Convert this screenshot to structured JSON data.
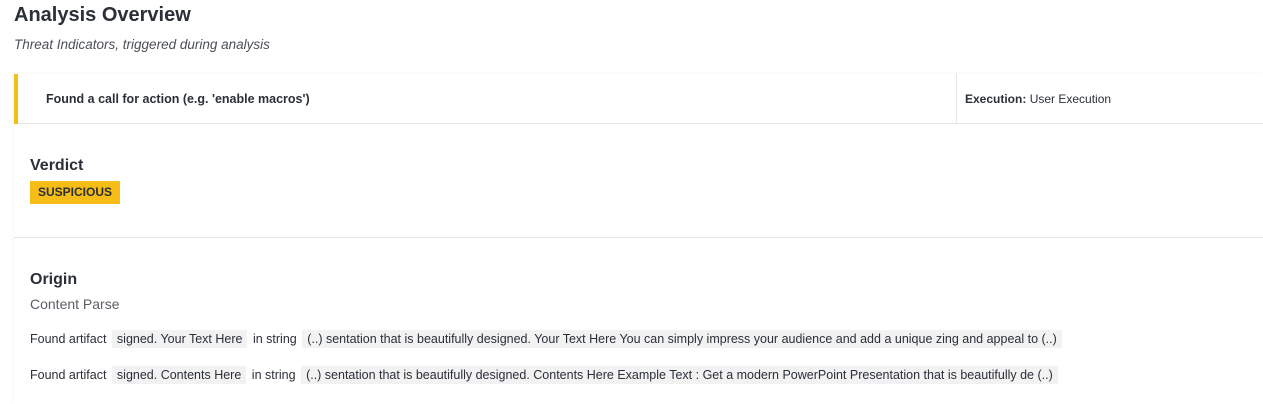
{
  "header": {
    "title": "Analysis Overview",
    "subtitle": "Threat Indicators, triggered during analysis"
  },
  "indicator": {
    "description": "Found a call for action (e.g. 'enable macros')",
    "category_label": "Execution:",
    "category_value": "User Execution",
    "accent_color": "#f6bd17"
  },
  "verdict": {
    "heading": "Verdict",
    "badge": "SUSPICIOUS",
    "badge_color": "#f6bd17"
  },
  "origin": {
    "heading": "Origin",
    "source": "Content Parse",
    "artifacts": [
      {
        "prefix": "Found artifact",
        "artifact": "signed. Your Text Here",
        "middle": "in string",
        "string": "(..) sentation that is beautifully designed. Your Text Here You can simply impress your audience and add a unique zing and appeal to  (..)"
      },
      {
        "prefix": "Found artifact",
        "artifact": "signed. Contents Here",
        "middle": "in string",
        "string": "(..) sentation that is beautifully designed. Contents Here Example Text : Get a modern PowerPoint Presentation that is beautifully de  (..)"
      }
    ]
  }
}
